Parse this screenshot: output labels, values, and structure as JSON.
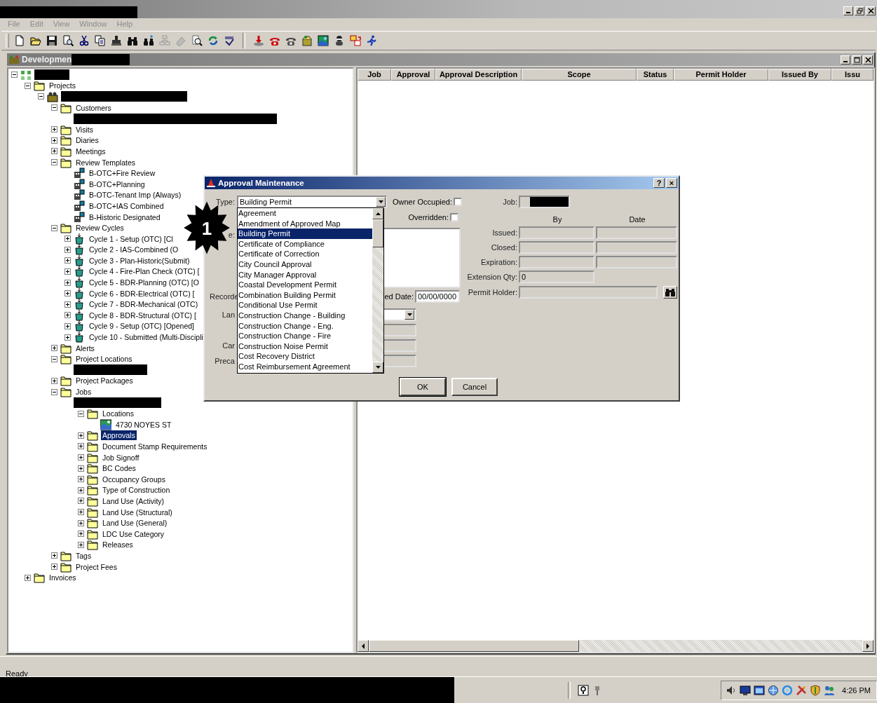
{
  "menu": [
    {
      "label": "File",
      "disabled": true
    },
    {
      "label": "Edit",
      "disabled": true
    },
    {
      "label": "View",
      "disabled": true
    },
    {
      "label": "Window",
      "disabled": true
    },
    {
      "label": "Help",
      "disabled": true
    }
  ],
  "child_window": {
    "title": "Developmen"
  },
  "tree": [
    {
      "kind": "root",
      "expanded": true,
      "children": [
        {
          "kind": "folder",
          "label": "Projects",
          "expanded": true,
          "selected": false,
          "children": [
            {
              "kind": "project",
              "expanded": true,
              "children": [
                {
                  "kind": "folder",
                  "label": "Customers",
                  "expanded": true,
                  "selected": false,
                  "children": [
                    {
                      "kind": "blank"
                    }
                  ]
                },
                {
                  "kind": "folder",
                  "label": "Visits",
                  "expanded": false,
                  "selected": false
                },
                {
                  "kind": "folder",
                  "label": "Diaries",
                  "expanded": false,
                  "selected": false
                },
                {
                  "kind": "folder",
                  "label": "Meetings",
                  "expanded": false,
                  "selected": false
                },
                {
                  "kind": "folder",
                  "label": "Review Templates",
                  "expanded": true,
                  "selected": false,
                  "children": [
                    {
                      "kind": "template",
                      "label": "B-OTC+Fire Review",
                      "selected": false
                    },
                    {
                      "kind": "template",
                      "label": "B-OTC+Planning",
                      "selected": false
                    },
                    {
                      "kind": "template",
                      "label": "B-OTC-Tenant Imp (Always)",
                      "selected": false
                    },
                    {
                      "kind": "template",
                      "label": "B-OTC+IAS Combined",
                      "selected": false
                    },
                    {
                      "kind": "template",
                      "label": "B-Historic Designated",
                      "selected": false
                    }
                  ]
                },
                {
                  "kind": "folder",
                  "label": "Review Cycles",
                  "expanded": true,
                  "selected": false,
                  "children": [
                    {
                      "kind": "cycle",
                      "label": "Cycle 1 - Setup (OTC) [Cl",
                      "expanded": false,
                      "selected": false
                    },
                    {
                      "kind": "cycle",
                      "label": "Cycle 2 - IAS-Combined (O",
                      "expanded": false,
                      "selected": false
                    },
                    {
                      "kind": "cycle",
                      "label": "Cycle 3 - Plan-Historic(Submit)",
                      "expanded": false,
                      "selected": false
                    },
                    {
                      "kind": "cycle",
                      "label": "Cycle 4 - Fire-Plan Check (OTC) [",
                      "expanded": false,
                      "selected": false
                    },
                    {
                      "kind": "cycle",
                      "label": "Cycle 5 - BDR-Planning (OTC) [O",
                      "expanded": false,
                      "selected": false
                    },
                    {
                      "kind": "cycle",
                      "label": "Cycle 6 - BDR-Electrical (OTC) [",
                      "expanded": false,
                      "selected": false
                    },
                    {
                      "kind": "cycle",
                      "label": "Cycle 7 - BDR-Mechanical (OTC)",
                      "expanded": false,
                      "selected": false
                    },
                    {
                      "kind": "cycle",
                      "label": "Cycle 8 - BDR-Structural (OTC) [",
                      "expanded": false,
                      "selected": false
                    },
                    {
                      "kind": "cycle",
                      "label": "Cycle 9 - Setup (OTC) [Opened]",
                      "expanded": false,
                      "selected": false
                    },
                    {
                      "kind": "cycle",
                      "label": "Cycle 10 - Submitted (Multi-Discipli",
                      "expanded": false,
                      "selected": false
                    }
                  ]
                },
                {
                  "kind": "folder",
                  "label": "Alerts",
                  "expanded": false,
                  "selected": false
                },
                {
                  "kind": "folder",
                  "label": "Project Locations",
                  "expanded": true,
                  "selected": false,
                  "children": [
                    {
                      "kind": "blank"
                    }
                  ]
                },
                {
                  "kind": "folder",
                  "label": "Project Packages",
                  "expanded": false,
                  "selected": false
                },
                {
                  "kind": "folder",
                  "label": "Jobs",
                  "expanded": true,
                  "selected": false,
                  "children": [
                    {
                      "kind": "blank",
                      "children": [
                        {
                          "kind": "folder",
                          "label": "Locations",
                          "expanded": true,
                          "selected": false,
                          "children": [
                            {
                              "kind": "location",
                              "label": "4730 NOYES ST",
                              "selected": false
                            }
                          ]
                        },
                        {
                          "kind": "folder",
                          "label": "Approvals",
                          "expanded": false,
                          "selected": true
                        },
                        {
                          "kind": "folder",
                          "label": "Document Stamp Requirements",
                          "expanded": false,
                          "selected": false
                        },
                        {
                          "kind": "folder",
                          "label": "Job Signoff",
                          "expanded": false,
                          "selected": false
                        },
                        {
                          "kind": "folder",
                          "label": "BC Codes",
                          "expanded": false,
                          "selected": false
                        },
                        {
                          "kind": "folder",
                          "label": "Occupancy Groups",
                          "expanded": false,
                          "selected": false
                        },
                        {
                          "kind": "folder",
                          "label": "Type of Construction",
                          "expanded": false,
                          "selected": false
                        },
                        {
                          "kind": "folder",
                          "label": "Land Use (Activity)",
                          "expanded": false,
                          "selected": false
                        },
                        {
                          "kind": "folder",
                          "label": "Land Use (Structural)",
                          "expanded": false,
                          "selected": false
                        },
                        {
                          "kind": "folder",
                          "label": "Land Use (General)",
                          "expanded": false,
                          "selected": false
                        },
                        {
                          "kind": "folder",
                          "label": "LDC Use Category",
                          "expanded": false,
                          "selected": false
                        },
                        {
                          "kind": "folder",
                          "label": "Releases",
                          "expanded": false,
                          "selected": false
                        }
                      ]
                    }
                  ]
                },
                {
                  "kind": "folder",
                  "label": "Tags",
                  "expanded": false,
                  "selected": false
                },
                {
                  "kind": "folder",
                  "label": "Project Fees",
                  "expanded": false,
                  "selected": false
                }
              ]
            }
          ]
        },
        {
          "kind": "folder",
          "label": "Invoices",
          "expanded": false,
          "selected": false
        }
      ]
    }
  ],
  "grid": {
    "columns": [
      "Job",
      "Approval",
      "Approval Description",
      "Scope",
      "Status",
      "Permit Holder",
      "Issued By",
      "Issu"
    ]
  },
  "dialog": {
    "title": "Approval Maintenance",
    "title_buttons": [
      "?",
      "×"
    ],
    "type": {
      "label": "Type:",
      "value": "Building Permit",
      "options": [
        {
          "label": "Agreement",
          "selected": false
        },
        {
          "label": "Amendment of Approved Map",
          "selected": false
        },
        {
          "label": "Building Permit",
          "selected": true
        },
        {
          "label": "Certificate of Compliance",
          "selected": false
        },
        {
          "label": "Certificate of Correction",
          "selected": false
        },
        {
          "label": "City Council Approval",
          "selected": false
        },
        {
          "label": "City Manager Approval",
          "selected": false
        },
        {
          "label": "Coastal Development Permit",
          "selected": false
        },
        {
          "label": "Combination Building Permit",
          "selected": false
        },
        {
          "label": "Conditional Use Permit",
          "selected": false
        },
        {
          "label": "Construction Change - Building",
          "selected": false
        },
        {
          "label": "Construction Change - Eng.",
          "selected": false
        },
        {
          "label": "Construction Change - Fire",
          "selected": false
        },
        {
          "label": "Construction Noise Permit",
          "selected": false
        },
        {
          "label": "Cost Recovery District",
          "selected": false
        },
        {
          "label": "Cost Reimbursement Agreement",
          "selected": false
        }
      ]
    },
    "owner_occupied": {
      "label": "Owner Occupied:",
      "checked": false
    },
    "overridden": {
      "label": "Overridden:",
      "checked": false
    },
    "description_label": "e:",
    "recorded_label": "Recorde",
    "date": {
      "label": "ed Date:",
      "value": "00/00/0000"
    },
    "left_fields": [
      {
        "label": "Lan",
        "kind": "select"
      },
      {
        "kind": "text"
      },
      {
        "label": "Car",
        "kind": "text"
      },
      {
        "label": "Preca",
        "kind": "text"
      }
    ],
    "job_label": "Job:",
    "headers": [
      "By",
      "Date"
    ],
    "date_rows": [
      {
        "label": "Issued:"
      },
      {
        "label": "Closed:"
      },
      {
        "label": "Expiration:"
      }
    ],
    "extension": {
      "label": "Extension Qty:",
      "value": "0"
    },
    "permit_holder": {
      "label": "Permit Holder:"
    },
    "buttons": [
      "OK",
      "Cancel"
    ]
  },
  "annotation": {
    "label": "1"
  },
  "status_bar": {
    "text": "Ready"
  },
  "taskbar": {
    "clock": "4:26 PM"
  }
}
